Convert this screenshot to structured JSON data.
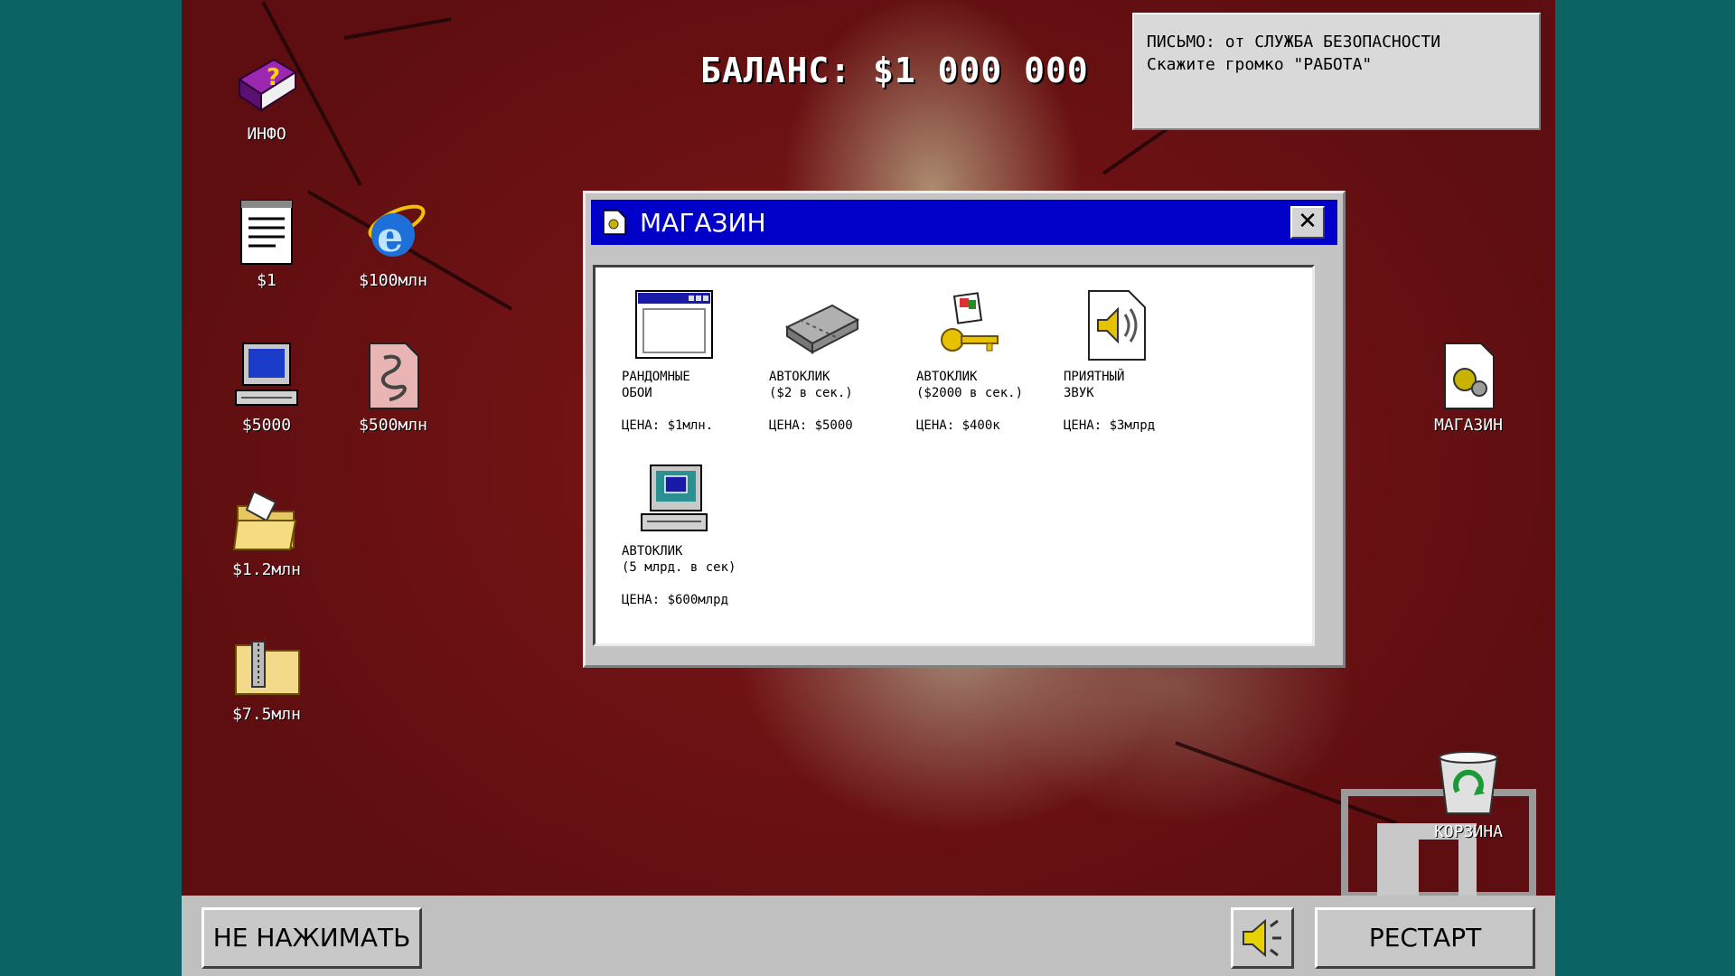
{
  "balance": "БАЛАНС: $1 000 000",
  "mail": {
    "line1": "ПИСЬМО: от СЛУЖБА БЕЗОПАСНОСТИ",
    "line2": "Скажите громко \"РАБОТА\""
  },
  "desktop_icons": [
    {
      "label": "ИНФО",
      "icon": "help-book-icon"
    },
    {
      "label": "$1",
      "icon": "notepad-icon"
    },
    {
      "label": "$100млн",
      "icon": "internet-explorer-icon"
    },
    {
      "label": "$5000",
      "icon": "computer-icon"
    },
    {
      "label": "$500млн",
      "icon": "script-icon"
    },
    {
      "label": "$1.2млн",
      "icon": "open-folder-icon"
    },
    {
      "label": "$7.5млн",
      "icon": "zip-folder-icon"
    },
    {
      "label": "МАГАЗИН",
      "icon": "settings-file-icon"
    },
    {
      "label": "КОРЗИНА",
      "icon": "recycle-bin-icon"
    }
  ],
  "shop": {
    "title": "МАГАЗИН",
    "close": "✕",
    "items": [
      {
        "name": "РАНДОМНЫЕ\nОБОИ",
        "price": "ЦЕНА: $1млн.",
        "icon": "window-icon"
      },
      {
        "name": "АВТОКЛИК\n($2 в сек.)",
        "price": "ЦЕНА: $5000",
        "icon": "memory-chip-icon"
      },
      {
        "name": "АВТОКЛИК\n($2000 в сек.)",
        "price": "ЦЕНА: $400к",
        "icon": "key-icon"
      },
      {
        "name": "ПРИЯТНЫЙ\nЗВУК",
        "price": "ЦЕНА: $3млрд",
        "icon": "sound-file-icon"
      },
      {
        "name": "АВТОКЛИК\n(5 млрд. в сек)",
        "price": "ЦЕНА: $600млрд",
        "icon": "computer-icon"
      }
    ]
  },
  "taskbar": {
    "dont_press": "НЕ НАЖИМАТЬ",
    "restart": "РЕСТАРТ",
    "sound_icon": "speaker-icon"
  },
  "colors": {
    "background": "#0c6363",
    "titlebar": "#0000c8",
    "wallpaper": "#7e1618"
  }
}
